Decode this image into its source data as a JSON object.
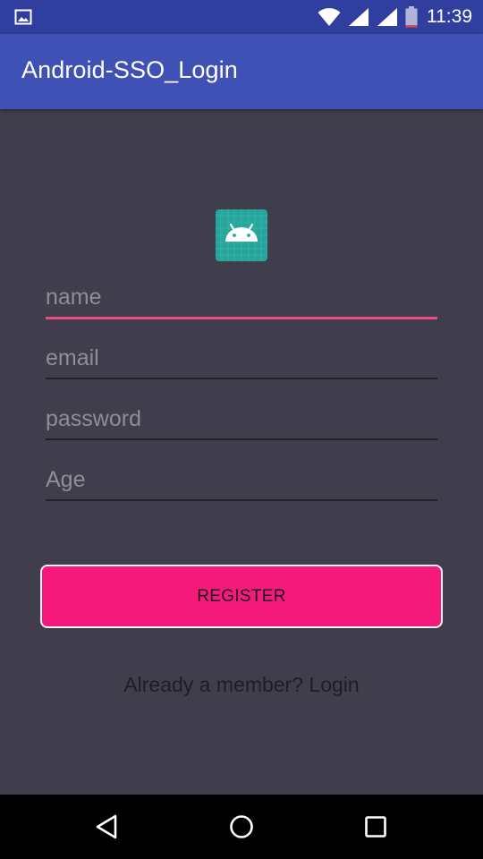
{
  "status_bar": {
    "time": "11:39",
    "icons": [
      "image-icon",
      "wifi-icon",
      "signal-icon",
      "signal-icon",
      "battery-icon"
    ]
  },
  "app_bar": {
    "title": "Android-SSO_Login"
  },
  "logo": {
    "icon": "android-icon",
    "color": "#26a69a"
  },
  "form": {
    "name_placeholder": "name",
    "email_placeholder": "email",
    "password_placeholder": "password",
    "age_placeholder": "Age",
    "register_label": "REGISTER",
    "login_link": "Already a member? Login"
  },
  "nav_bar": {
    "buttons": [
      "back-icon",
      "home-icon",
      "recents-icon"
    ]
  },
  "colors": {
    "status_bar": "#303f9f",
    "app_bar": "#3f51b5",
    "background": "#403e4c",
    "accent": "#f4197a",
    "focus_underline": "#e84d7f"
  }
}
